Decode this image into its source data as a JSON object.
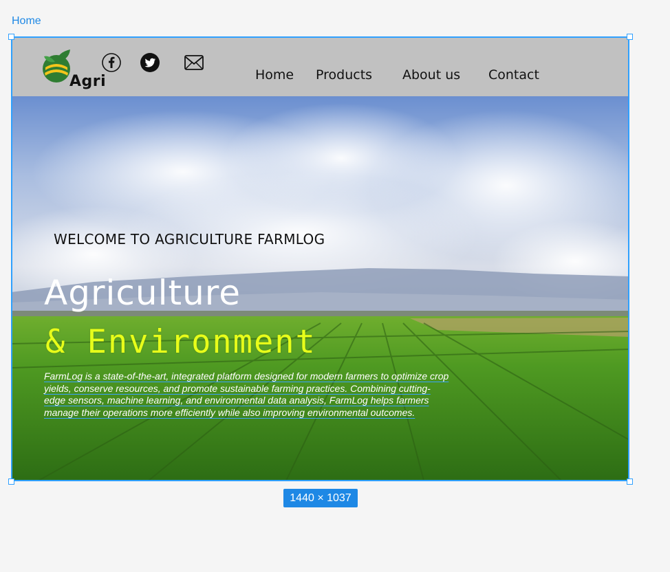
{
  "canvas": {
    "frame_label": "Home",
    "size_badge": "1440 × 1037"
  },
  "header": {
    "logo_text": "Agri",
    "social": [
      {
        "icon": "facebook-icon"
      },
      {
        "icon": "twitter-icon"
      },
      {
        "icon": "mail-icon"
      }
    ],
    "nav": [
      {
        "label": "Home"
      },
      {
        "label": "Products"
      },
      {
        "label": "About us"
      },
      {
        "label": "Contact"
      }
    ]
  },
  "hero": {
    "welcome": "WELCOME TO AGRICULTURE FARMLOG",
    "title_line1": "Agriculture",
    "title_line2": "& Environment",
    "description": "FarmLog is a state-of-the-art, integrated platform designed for modern farmers to optimize crop yields, conserve resources, and promote sustainable farming practices. Combining cutting-edge sensors, machine learning, and environmental data analysis, FarmLog helps farmers manage their operations more efficiently while also improving environmental outcomes."
  },
  "colors": {
    "selection": "#2ea0ff",
    "header_bg": "#c1c1c1",
    "title_accent": "#e8ff1a",
    "badge": "#1e88e5"
  }
}
